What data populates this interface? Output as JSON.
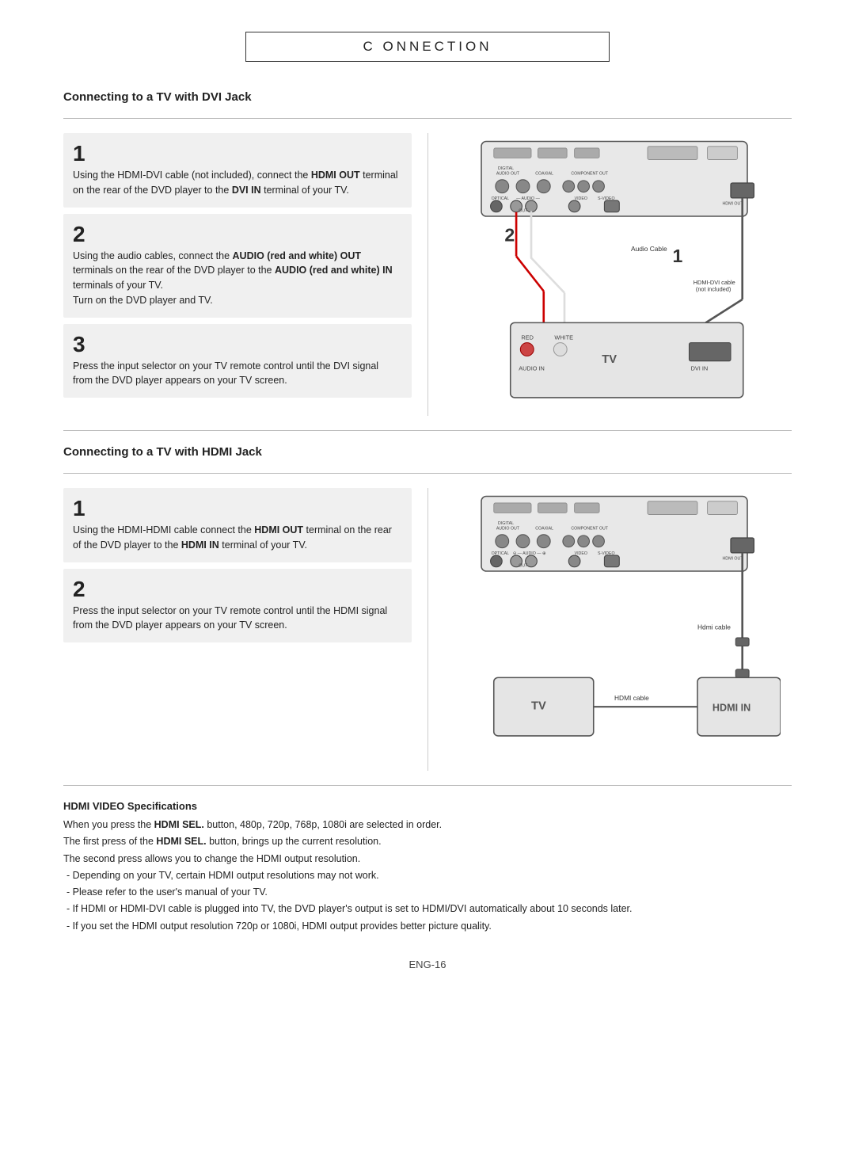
{
  "page": {
    "title": "C ONNECTION",
    "page_number": "ENG-16"
  },
  "dvi_section": {
    "heading": "Connecting to a TV with DVI Jack",
    "steps": [
      {
        "number": "1",
        "text": "Using the HDMI-DVI cable (not included), connect the <b>HDMI OUT</b> terminal on the rear of the DVD player to the <b>DVI IN</b> terminal of your TV."
      },
      {
        "number": "2",
        "text": "Using the audio cables, connect the <b>AUDIO (red and white) OUT</b> terminals on the rear of the DVD player to the <b>AUDIO (red and white) IN</b> terminals of your TV.\nTurn on the DVD player and TV."
      },
      {
        "number": "3",
        "text": "Press the input selector on your TV remote control until the DVI signal from the DVD player appears on your TV screen."
      }
    ]
  },
  "hdmi_section": {
    "heading": "Connecting to a TV with HDMI Jack",
    "steps": [
      {
        "number": "1",
        "text": "Using the HDMI-HDMI cable connect the <b>HDMI OUT</b> terminal on the rear of the DVD player to the <b>HDMI IN</b> terminal of your TV."
      },
      {
        "number": "2",
        "text": "Press the input selector on your TV remote control until the HDMI signal from the DVD player appears on your TV screen."
      }
    ]
  },
  "hdmi_specs": {
    "title": "HDMI VIDEO Specifications",
    "lines": [
      "When you press the <b>HDMI SEL.</b> button, 480p, 720p, 768p, 1080i are selected in order.",
      "The first press of the <b>HDMI SEL.</b> button, brings up the current resolution.",
      "The second press allows you to change the HDMI output resolution.",
      "- Depending on your TV, certain HDMI output resolutions may not work.",
      "- Please refer to the user's manual of your TV.",
      "- If HDMI or HDMI-DVI cable is plugged into TV, the DVD player’s output is set to HDMI/DVI automatically about 10 seconds later.",
      "- If you set the HDMI output resolution 720p or 1080i, HDMI output provides better picture quality."
    ]
  }
}
